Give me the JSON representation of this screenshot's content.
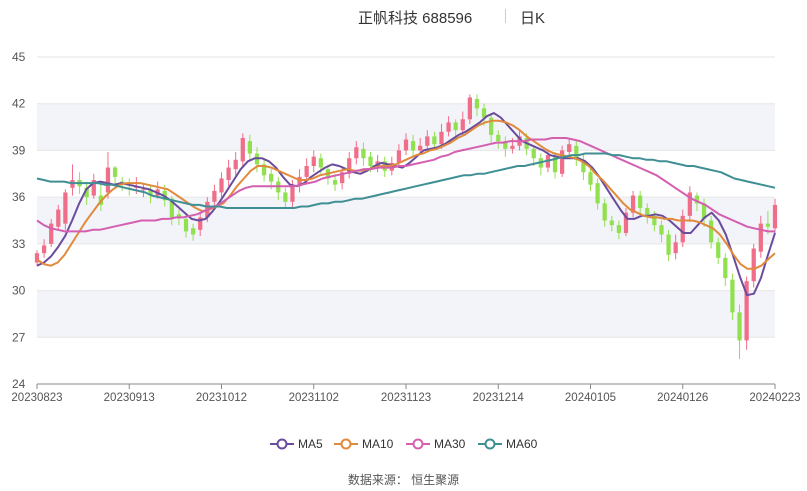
{
  "header": {
    "title": "正帆科技 688596",
    "period": "日K"
  },
  "legend": [
    {
      "name": "MA5",
      "color": "#6a4c9c"
    },
    {
      "name": "MA10",
      "color": "#e08a3c"
    },
    {
      "name": "MA30",
      "color": "#d45fb0"
    },
    {
      "name": "MA60",
      "color": "#3f8f94"
    }
  ],
  "source": "数据来源： 恒生聚源",
  "chart_data": {
    "type": "candlestick",
    "ylim": [
      24,
      45
    ],
    "y_ticks": [
      24,
      27,
      30,
      33,
      36,
      39,
      42,
      45
    ],
    "x_tick_labels": [
      "20230823",
      "20230913",
      "20231012",
      "20231102",
      "20231123",
      "20231214",
      "20240105",
      "20240126",
      "20240223"
    ],
    "colors": {
      "up": "#ef6e8a",
      "down": "#90e050"
    },
    "candles": [
      [
        31.8,
        32.4,
        31.6,
        32.6
      ],
      [
        32.4,
        32.9,
        32.1,
        33.3
      ],
      [
        33.0,
        34.3,
        32.8,
        34.6
      ],
      [
        34.1,
        35.2,
        33.9,
        35.5
      ],
      [
        34.3,
        36.3,
        33.9,
        36.5
      ],
      [
        36.6,
        37.1,
        36.1,
        38.1
      ],
      [
        37.1,
        36.7,
        36.2,
        37.6
      ],
      [
        36.6,
        36.0,
        35.5,
        37.0
      ],
      [
        36.1,
        37.1,
        35.9,
        37.5
      ],
      [
        36.1,
        35.5,
        35.1,
        36.8
      ],
      [
        36.3,
        37.9,
        35.9,
        38.9
      ],
      [
        37.9,
        37.3,
        36.8,
        38.0
      ],
      [
        37.0,
        36.9,
        36.4,
        37.3
      ],
      [
        36.6,
        36.5,
        36.1,
        37.2
      ],
      [
        36.6,
        36.7,
        36.2,
        37.3
      ],
      [
        36.5,
        36.5,
        36.0,
        36.9
      ],
      [
        36.5,
        36.1,
        35.6,
        36.8
      ],
      [
        36.1,
        36.5,
        35.9,
        37.0
      ],
      [
        36.4,
        35.8,
        35.4,
        36.8
      ],
      [
        35.9,
        34.7,
        34.2,
        36.1
      ],
      [
        34.9,
        34.7,
        34.2,
        35.2
      ],
      [
        34.6,
        33.8,
        33.4,
        35.0
      ],
      [
        34.0,
        33.6,
        33.2,
        34.3
      ],
      [
        33.9,
        34.7,
        33.5,
        35.0
      ],
      [
        34.7,
        35.7,
        34.4,
        36.0
      ],
      [
        35.7,
        36.4,
        35.3,
        36.8
      ],
      [
        36.3,
        37.2,
        36.0,
        37.6
      ],
      [
        37.1,
        37.9,
        36.7,
        38.4
      ],
      [
        37.8,
        38.4,
        37.4,
        38.9
      ],
      [
        38.3,
        39.8,
        38.0,
        40.1
      ],
      [
        39.6,
        38.8,
        38.4,
        40.0
      ],
      [
        38.8,
        38.1,
        37.6,
        39.2
      ],
      [
        38.1,
        37.4,
        37.0,
        38.5
      ],
      [
        37.5,
        37.0,
        36.5,
        37.8
      ],
      [
        37.0,
        36.3,
        35.8,
        37.3
      ],
      [
        36.3,
        35.7,
        35.3,
        36.6
      ],
      [
        35.7,
        36.7,
        35.3,
        37.1
      ],
      [
        36.7,
        37.3,
        36.3,
        37.8
      ],
      [
        37.3,
        38.0,
        36.9,
        38.5
      ],
      [
        38.0,
        38.6,
        37.6,
        39.0
      ],
      [
        38.5,
        37.9,
        37.5,
        38.8
      ],
      [
        37.8,
        37.2,
        36.8,
        38.1
      ],
      [
        37.1,
        36.8,
        36.4,
        37.5
      ],
      [
        36.9,
        37.6,
        36.5,
        38.0
      ],
      [
        37.5,
        38.5,
        37.2,
        38.9
      ],
      [
        38.5,
        39.2,
        38.1,
        39.6
      ],
      [
        39.1,
        38.5,
        38.0,
        39.5
      ],
      [
        38.6,
        38.0,
        37.6,
        38.9
      ],
      [
        38.0,
        38.3,
        37.6,
        38.7
      ],
      [
        38.3,
        37.7,
        37.3,
        38.6
      ],
      [
        37.7,
        38.2,
        37.4,
        38.6
      ],
      [
        38.2,
        39.0,
        37.9,
        39.4
      ],
      [
        39.0,
        39.7,
        38.7,
        40.1
      ],
      [
        39.6,
        39.0,
        38.6,
        40.0
      ],
      [
        39.0,
        39.3,
        38.7,
        39.8
      ],
      [
        39.3,
        39.9,
        39.0,
        40.3
      ],
      [
        39.9,
        39.4,
        39.0,
        40.2
      ],
      [
        39.4,
        40.2,
        39.1,
        40.7
      ],
      [
        40.2,
        40.8,
        39.9,
        41.2
      ],
      [
        40.8,
        40.3,
        39.9,
        41.0
      ],
      [
        40.3,
        41.0,
        40.0,
        41.5
      ],
      [
        41.0,
        42.4,
        40.7,
        42.6
      ],
      [
        42.3,
        41.7,
        41.2,
        42.6
      ],
      [
        41.7,
        41.1,
        40.6,
        42.0
      ],
      [
        41.1,
        40.0,
        39.5,
        41.4
      ],
      [
        40.0,
        39.6,
        39.1,
        40.3
      ],
      [
        39.6,
        39.1,
        38.6,
        39.9
      ],
      [
        39.1,
        39.3,
        38.8,
        39.8
      ],
      [
        39.3,
        39.9,
        39.0,
        40.3
      ],
      [
        39.8,
        39.1,
        38.7,
        40.1
      ],
      [
        39.1,
        38.5,
        38.0,
        39.3
      ],
      [
        38.5,
        37.9,
        37.4,
        38.8
      ],
      [
        37.9,
        38.7,
        37.6,
        39.1
      ],
      [
        38.6,
        37.6,
        37.2,
        38.9
      ],
      [
        37.5,
        39.0,
        37.3,
        39.3
      ],
      [
        38.9,
        39.4,
        38.6,
        39.8
      ],
      [
        39.3,
        38.4,
        38.0,
        39.7
      ],
      [
        38.4,
        37.6,
        37.1,
        38.7
      ],
      [
        37.6,
        36.8,
        36.4,
        37.9
      ],
      [
        36.9,
        35.6,
        35.2,
        37.2
      ],
      [
        35.6,
        34.5,
        34.1,
        35.9
      ],
      [
        34.5,
        34.2,
        33.8,
        34.8
      ],
      [
        34.2,
        33.7,
        33.3,
        34.5
      ],
      [
        33.7,
        35.0,
        33.5,
        35.3
      ],
      [
        35.0,
        36.1,
        34.7,
        36.4
      ],
      [
        36.1,
        35.3,
        34.9,
        36.4
      ],
      [
        35.3,
        34.8,
        34.3,
        35.6
      ],
      [
        34.8,
        34.2,
        33.8,
        35.1
      ],
      [
        34.2,
        33.6,
        33.1,
        34.5
      ],
      [
        33.6,
        32.3,
        31.9,
        33.9
      ],
      [
        32.4,
        33.1,
        32.0,
        33.6
      ],
      [
        33.1,
        34.8,
        32.8,
        35.2
      ],
      [
        34.8,
        36.3,
        34.4,
        36.7
      ],
      [
        36.1,
        35.6,
        35.1,
        36.3
      ],
      [
        35.6,
        34.6,
        34.1,
        35.9
      ],
      [
        34.5,
        33.1,
        32.7,
        34.8
      ],
      [
        33.1,
        32.1,
        31.7,
        33.4
      ],
      [
        32.1,
        30.8,
        30.3,
        32.4
      ],
      [
        30.7,
        28.6,
        28.1,
        31.1
      ],
      [
        28.6,
        26.8,
        25.6,
        29.1
      ],
      [
        26.8,
        30.6,
        26.2,
        30.9
      ],
      [
        30.6,
        32.7,
        30.2,
        33.0
      ],
      [
        32.5,
        34.3,
        32.1,
        34.8
      ],
      [
        34.3,
        34.1,
        33.6,
        35.1
      ],
      [
        34.0,
        35.5,
        33.7,
        35.9
      ]
    ],
    "series": [
      {
        "name": "MA5",
        "color": "#6a4c9c",
        "values": [
          31.6,
          31.8,
          32.2,
          32.8,
          33.5,
          34.5,
          35.6,
          36.5,
          36.9,
          37.0,
          36.9,
          36.8,
          36.9,
          36.8,
          36.7,
          36.6,
          36.5,
          36.3,
          36.1,
          35.8,
          35.4,
          35.0,
          34.6,
          34.5,
          34.6,
          35.1,
          35.7,
          36.4,
          37.1,
          37.8,
          38.3,
          38.5,
          38.5,
          38.3,
          37.9,
          37.3,
          36.8,
          36.7,
          36.9,
          37.3,
          37.6,
          37.9,
          38.1,
          38.0,
          37.8,
          37.6,
          37.5,
          37.7,
          38.0,
          38.2,
          38.1,
          38.0,
          37.9,
          38.2,
          38.6,
          39.0,
          39.1,
          39.2,
          39.4,
          39.7,
          40.0,
          40.2,
          40.5,
          40.8,
          41.2,
          41.4,
          41.1,
          40.6,
          40.1,
          39.6,
          39.4,
          39.2,
          39.0,
          38.7,
          38.6,
          38.5,
          38.5,
          38.5,
          38.3,
          37.9,
          37.3,
          36.6,
          35.9,
          35.2,
          34.6,
          34.6,
          34.8,
          34.8,
          34.9,
          34.8,
          34.5,
          34.1,
          33.7,
          33.7,
          34.2,
          34.7,
          35.0,
          34.5,
          33.6,
          32.3,
          30.9,
          29.7,
          29.8,
          30.8,
          32.3,
          33.7
        ]
      },
      {
        "name": "MA10",
        "color": "#e08a3c",
        "values": [
          32.0,
          31.7,
          31.6,
          31.8,
          32.3,
          33.0,
          33.7,
          34.4,
          35.0,
          35.6,
          36.1,
          36.5,
          36.8,
          36.9,
          36.9,
          36.9,
          36.8,
          36.7,
          36.6,
          36.5,
          36.2,
          35.9,
          35.6,
          35.3,
          35.1,
          35.2,
          35.4,
          35.6,
          36.1,
          36.7,
          37.2,
          37.7,
          38.0,
          38.0,
          37.9,
          37.7,
          37.5,
          37.3,
          37.1,
          37.1,
          37.2,
          37.4,
          37.5,
          37.6,
          37.7,
          37.8,
          37.7,
          37.7,
          37.8,
          37.9,
          38.0,
          38.0,
          38.1,
          38.3,
          38.5,
          38.7,
          38.8,
          39.0,
          39.1,
          39.3,
          39.5,
          39.8,
          40.0,
          40.3,
          40.6,
          40.8,
          40.9,
          40.9,
          40.8,
          40.6,
          40.3,
          39.9,
          39.6,
          39.3,
          39.0,
          38.8,
          38.7,
          38.6,
          38.5,
          38.3,
          38.0,
          37.5,
          37.1,
          36.6,
          36.1,
          35.6,
          35.2,
          35.0,
          34.8,
          34.7,
          34.7,
          34.6,
          34.6,
          34.5,
          34.5,
          34.5,
          34.4,
          34.2,
          34.0,
          33.6,
          33.0,
          32.3,
          31.7,
          31.4,
          31.4,
          31.6,
          32.0,
          32.4
        ]
      },
      {
        "name": "MA30",
        "color": "#d45fb0",
        "values": [
          34.5,
          34.2,
          34.0,
          33.9,
          33.8,
          33.8,
          33.8,
          33.8,
          33.9,
          33.9,
          34.0,
          34.1,
          34.2,
          34.3,
          34.4,
          34.5,
          34.5,
          34.5,
          34.6,
          34.6,
          34.7,
          34.7,
          34.8,
          34.9,
          35.1,
          35.3,
          35.5,
          35.8,
          36.1,
          36.4,
          36.6,
          36.7,
          36.7,
          36.7,
          36.7,
          36.7,
          36.7,
          36.7,
          36.8,
          36.9,
          37.0,
          37.2,
          37.3,
          37.4,
          37.5,
          37.6,
          37.7,
          37.8,
          37.8,
          37.9,
          37.9,
          37.9,
          38.0,
          38.0,
          38.1,
          38.2,
          38.3,
          38.4,
          38.6,
          38.7,
          38.9,
          39.0,
          39.1,
          39.2,
          39.3,
          39.4,
          39.5,
          39.5,
          39.6,
          39.6,
          39.6,
          39.7,
          39.7,
          39.7,
          39.8,
          39.8,
          39.8,
          39.7,
          39.6,
          39.4,
          39.2,
          39.0,
          38.8,
          38.6,
          38.4,
          38.2,
          38.0,
          37.8,
          37.6,
          37.4,
          37.1,
          36.8,
          36.5,
          36.2,
          35.9,
          35.7,
          35.5,
          35.2,
          34.9,
          34.7,
          34.5,
          34.3,
          34.1,
          34.0,
          33.9,
          33.8,
          33.8
        ]
      },
      {
        "name": "MA60",
        "color": "#3f8f94",
        "values": [
          37.2,
          37.1,
          37.0,
          37.0,
          37.0,
          36.9,
          36.9,
          36.9,
          36.9,
          36.9,
          36.8,
          36.8,
          36.7,
          36.6,
          36.5,
          36.4,
          36.3,
          36.1,
          36.0,
          35.9,
          35.8,
          35.7,
          35.6,
          35.5,
          35.5,
          35.4,
          35.4,
          35.4,
          35.3,
          35.3,
          35.3,
          35.3,
          35.3,
          35.3,
          35.3,
          35.3,
          35.3,
          35.3,
          35.3,
          35.4,
          35.4,
          35.5,
          35.6,
          35.6,
          35.7,
          35.7,
          35.8,
          35.9,
          35.9,
          36.0,
          36.1,
          36.2,
          36.3,
          36.4,
          36.5,
          36.6,
          36.7,
          36.8,
          36.9,
          37.0,
          37.1,
          37.2,
          37.3,
          37.4,
          37.4,
          37.5,
          37.5,
          37.6,
          37.7,
          37.8,
          37.9,
          38.0,
          38.0,
          38.1,
          38.2,
          38.3,
          38.4,
          38.5,
          38.6,
          38.7,
          38.7,
          38.8,
          38.8,
          38.8,
          38.8,
          38.7,
          38.7,
          38.6,
          38.5,
          38.5,
          38.4,
          38.4,
          38.3,
          38.3,
          38.2,
          38.1,
          38.0,
          38.0,
          37.9,
          37.8,
          37.7,
          37.6,
          37.4,
          37.2,
          37.1,
          37.0,
          36.9,
          36.8,
          36.7,
          36.6
        ]
      }
    ]
  }
}
